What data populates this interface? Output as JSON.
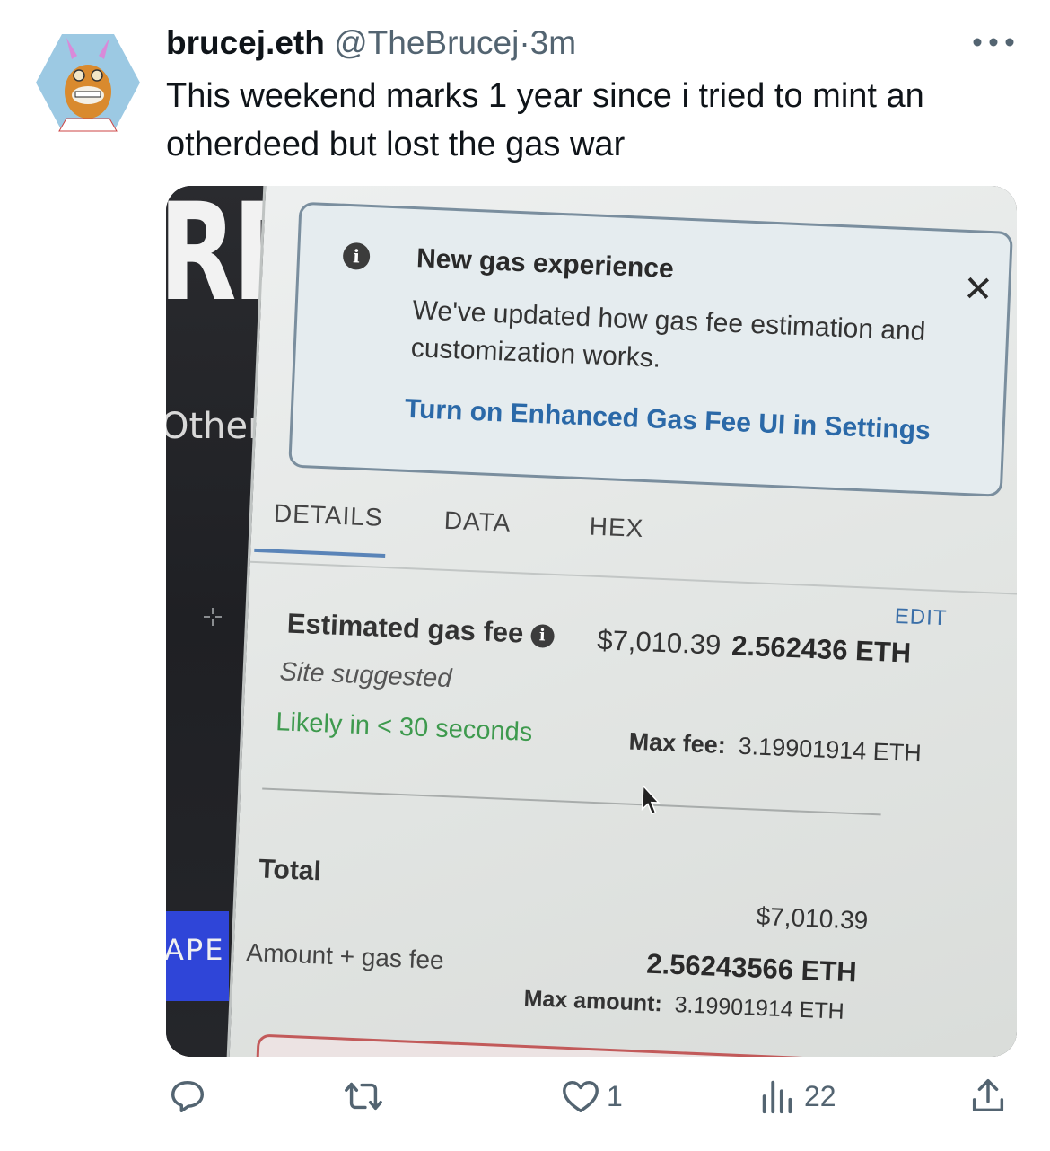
{
  "tweet": {
    "display_name": "brucej.eth",
    "handle": "@TheBrucej",
    "separator": "·",
    "time": "3m",
    "text": "This weekend marks 1 year since i tried to mint an otherdeed but lost the gas war"
  },
  "photo": {
    "bg_fragment_top": "RDI",
    "bg_fragment_other": "Other",
    "bg_fragment_ape": "APE",
    "notice": {
      "title": "New gas experience",
      "body": "We've updated how gas fee estimation and customization works.",
      "link": "Turn on Enhanced Gas Fee UI in Settings"
    },
    "tabs": [
      "DETAILS",
      "DATA",
      "HEX"
    ],
    "edit_label": "EDIT",
    "estimated_gas_fee_label": "Estimated gas fee",
    "estimated_usd": "$7,010.39",
    "estimated_eth": "2.562436 ETH",
    "site_suggested": "Site suggested",
    "likely_time": "Likely in < 30 seconds",
    "max_fee_label": "Max fee:",
    "max_fee_value": "3.19901914 ETH",
    "total_label": "Total",
    "total_usd": "$7,010.39",
    "total_eth": "2.56243566 ETH",
    "amount_gas_label": "Amount + gas fee",
    "max_amount_label": "Max amount:",
    "max_amount_value": "3.19901914 ETH"
  },
  "actions": {
    "reply_count": "",
    "retweet_count": "",
    "like_count": "1",
    "views_count": "22"
  },
  "colors": {
    "text_primary": "#0f1419",
    "text_secondary": "#536471",
    "link_blue": "#2b69a8",
    "likely_green": "#3e9a4e"
  },
  "icons": [
    "more-icon",
    "info-icon",
    "close-icon",
    "reply-icon",
    "retweet-icon",
    "like-icon",
    "views-icon",
    "share-icon"
  ]
}
